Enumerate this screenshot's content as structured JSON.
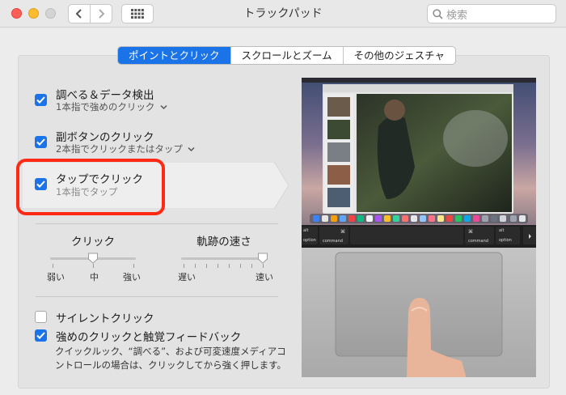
{
  "window": {
    "title": "トラックパッド",
    "search_placeholder": "検索"
  },
  "tabs": [
    {
      "label": "ポイントとクリック",
      "active": true
    },
    {
      "label": "スクロールとズーム",
      "active": false
    },
    {
      "label": "その他のジェスチャ",
      "active": false
    }
  ],
  "options": {
    "lookup": {
      "title": "調べる＆データ検出",
      "sub": "1本指で強めのクリック",
      "checked": true
    },
    "secondary": {
      "title": "副ボタンのクリック",
      "sub": "2本指でクリックまたはタップ",
      "checked": true
    },
    "tap": {
      "title": "タップでクリック",
      "sub": "1本指でタップ",
      "checked": true
    }
  },
  "click_slider": {
    "label": "クリック",
    "ticks": [
      "弱い",
      "中",
      "強い"
    ],
    "value": "中"
  },
  "speed_slider": {
    "label": "軌跡の速さ",
    "ticks": [
      "遅い",
      "速い"
    ],
    "value": 1.0
  },
  "silent_click": {
    "label": "サイレントクリック",
    "checked": false
  },
  "force_click": {
    "label": "強めのクリックと触覚フィードバック",
    "checked": true,
    "description": "クイックルック、“調べる”、および可変速度メディアコントロールの場合は、クリックしてから強く押します。"
  },
  "preview": {
    "keys": {
      "option_left": "option",
      "alt_left": "alt",
      "command_left": "command",
      "cmd_symbol_left": "⌘",
      "command_right": "command",
      "cmd_symbol_right": "⌘",
      "option_right": "option",
      "alt_right": "alt"
    }
  },
  "colors": {
    "accent": "#1a73e8",
    "highlight_ring": "#ff2a16"
  }
}
